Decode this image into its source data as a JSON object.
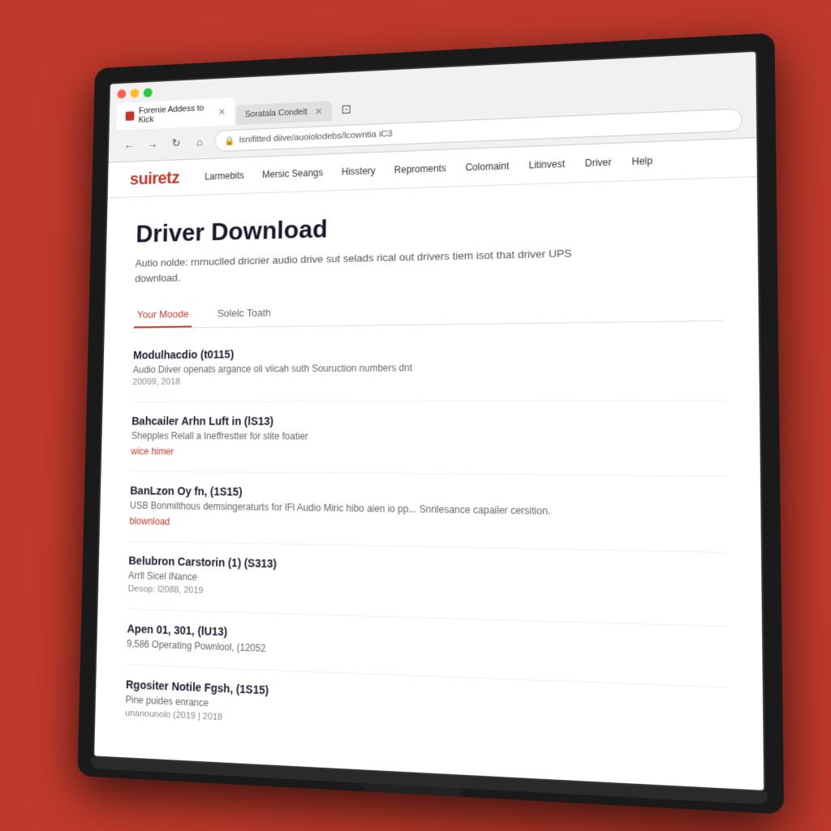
{
  "browser": {
    "tabs": [
      {
        "id": "tab1",
        "label": "Forenie Addess to Kick",
        "active": true
      },
      {
        "id": "tab2",
        "label": "Soratala Condelt",
        "active": false
      }
    ],
    "address": "lsnifitted diive/auoiolodebs/lcowntia iC3",
    "nav_back": "←",
    "nav_forward": "→",
    "nav_refresh": "↻",
    "nav_home": "⌂"
  },
  "site": {
    "logo": "suiretz",
    "nav_items": [
      "Larmebits",
      "Mersic Seangs",
      "Hisstery",
      "Reproments",
      "Colomaint",
      "Litinvest",
      "Driver",
      "Help"
    ]
  },
  "page": {
    "title": "Driver Download",
    "description": "Autio nolde: rnrnuclled dricrier audio drive sut selads rical out drivers tiem isot that driver UPS download.",
    "tabs": [
      {
        "id": "your-moode",
        "label": "Your Moode",
        "active": true
      },
      {
        "id": "solelc-toath",
        "label": "Solelc Toath",
        "active": false
      }
    ],
    "drivers": [
      {
        "id": "d1",
        "name": "Modulhacdio (t0115)",
        "desc": "Audio Diiver openats argance oli viicah suth Souruction numbers dnt",
        "date": "20099, 2018",
        "link": null
      },
      {
        "id": "d2",
        "name": "Bahcailer Arhn Luft in (lS13)",
        "desc": "Shepples Relall a Ineffrestter for slite foatier",
        "date": null,
        "link": "wice himer"
      },
      {
        "id": "d3",
        "name": "BanLzon Oy fn, (1S15)",
        "desc": "USB Bonmilthous demsingeraturts for lFl Audio Miric hibo aien io pp... Snrilesance capailer cersition.",
        "date": null,
        "link": "blownload"
      },
      {
        "id": "d4",
        "name": "Belubron Carstorin (1) (S313)",
        "desc": "Arrll Sicel lNance",
        "date": "Desop: l2088, 2019",
        "link": null
      },
      {
        "id": "d5",
        "name": "Apen 01, 301, (lU13)",
        "desc": "9,586 Operating Pownlool, (12052",
        "date": null,
        "link": null
      },
      {
        "id": "d6",
        "name": "Rgositer Notile Fgsh, (1S15)",
        "desc": "Pine puides enrance",
        "date": "unanounolo (2019 | 2018",
        "link": null
      }
    ]
  },
  "colors": {
    "accent": "#c0392b",
    "text_primary": "#1a1a2e",
    "text_secondary": "#555",
    "text_muted": "#888"
  }
}
